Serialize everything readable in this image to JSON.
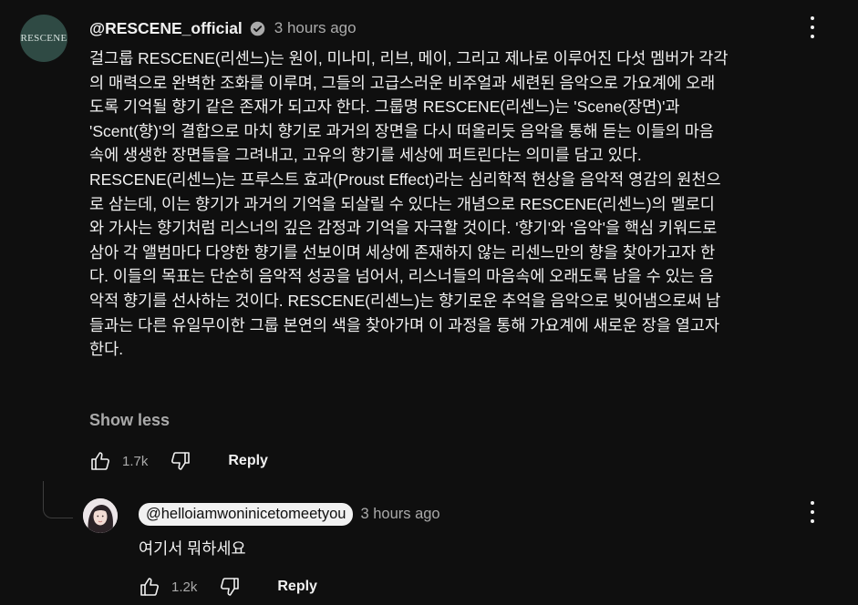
{
  "comment": {
    "avatar_text": "RESCENE",
    "author": "@RESCENE_official",
    "timestamp": "3 hours ago",
    "body": "걸그룹 RESCENE(리센느)는 원이, 미나미, 리브, 메이, 그리고 제나로 이루어진 다섯 멤버가 각각\n의 매력으로 완벽한 조화를 이루며, 그들의 고급스러운 비주얼과 세련된 음악으로 가요계에 오래\n도록 기억될 향기 같은 존재가 되고자 한다. 그룹명 RESCENE(리센느)는 'Scene(장면)'과\n'Scent(향)'의 결합으로 마치 향기로 과거의 장면을 다시 떠올리듯 음악을 통해 듣는 이들의 마음\n속에 생생한 장면들을 그려내고, 고유의 향기를 세상에 퍼트린다는 의미를 담고 있다.\nRESCENE(리센느)는 프루스트 효과(Proust Effect)라는 심리학적 현상을 음악적 영감의 원천으\n로 삼는데, 이는 향기가 과거의 기억을 되살릴 수 있다는 개념으로 RESCENE(리센느)의 멜로디\n와 가사는 향기처럼 리스너의 깊은 감정과 기억을 자극할 것이다. '향기'와 '음악'을 핵심 키워드로\n삼아 각 앨범마다 다양한 향기를 선보이며 세상에 존재하지 않는 리센느만의 향을 찾아가고자 한\n다. 이들의 목표는 단순히 음악적 성공을 넘어서, 리스너들의 마음속에 오래도록 남을 수 있는 음\n악적 향기를 선사하는 것이다. RESCENE(리센느)는 향기로운 추억을 음악으로 빚어냄으로써 남\n들과는 다른 유일무이한 그룹 본연의 색을 찾아가며 이 과정을 통해 가요계에 새로운 장을 열고자\n한다.",
    "show_less": "Show less",
    "like_count": "1.7k",
    "reply_label": "Reply"
  },
  "reply": {
    "author": "@helloiamwoninicetomeetyou",
    "timestamp": "3 hours ago",
    "text": "여기서 뭐하세요",
    "like_count": "1.2k",
    "reply_label": "Reply"
  },
  "icons": {
    "verified": "verified-check-icon",
    "like": "thumbs-up-icon",
    "dislike": "thumbs-down-icon",
    "more": "more-vert-icon"
  },
  "colors": {
    "background": "#0f0f0f",
    "text_primary": "#f1f1f1",
    "text_secondary": "#aaaaaa",
    "avatar_bg": "#2f4a44"
  }
}
